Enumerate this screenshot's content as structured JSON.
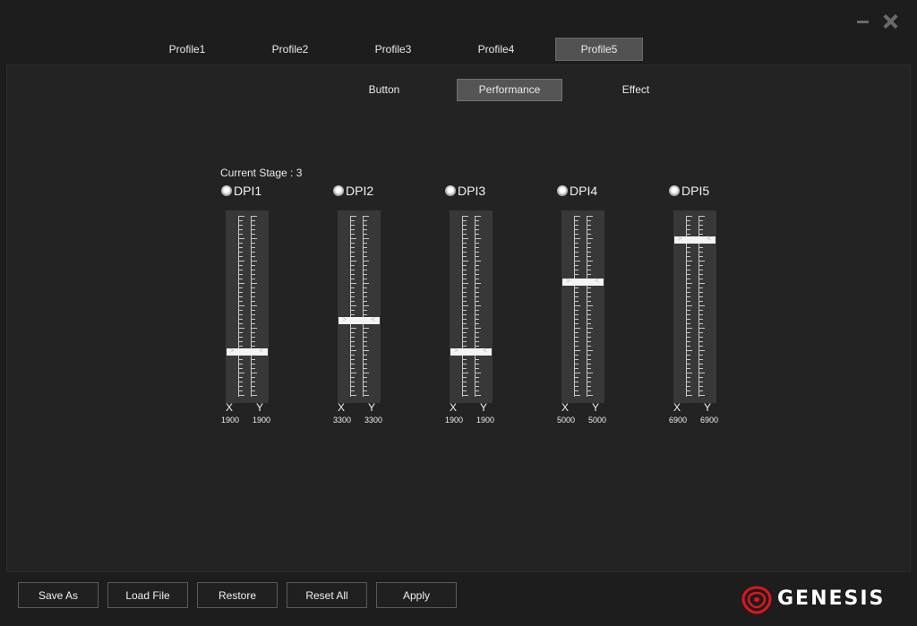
{
  "window": {
    "minimize_icon": "minimize-icon",
    "close_icon": "close-icon"
  },
  "profiles": {
    "tabs": [
      "Profile1",
      "Profile2",
      "Profile3",
      "Profile4",
      "Profile5"
    ],
    "active": "Profile5"
  },
  "subtabs": {
    "tabs": [
      "Button",
      "Performance",
      "Effect"
    ],
    "active": "Performance"
  },
  "performance": {
    "current_stage": "Current Stage : 3",
    "x_label": "X",
    "y_label": "Y",
    "dpi_stages": [
      {
        "label": "DPI1",
        "x": "1900",
        "y": "1900",
        "level": 0.245
      },
      {
        "label": "DPI2",
        "x": "3300",
        "y": "3300",
        "level": 0.425
      },
      {
        "label": "DPI3",
        "x": "1900",
        "y": "1900",
        "level": 0.245
      },
      {
        "label": "DPI4",
        "x": "5000",
        "y": "5000",
        "level": 0.645
      },
      {
        "label": "DPI5",
        "x": "6900",
        "y": "6900",
        "level": 0.885
      }
    ]
  },
  "footer": {
    "save_as": "Save As",
    "load_file": "Load File",
    "restore": "Restore",
    "reset_all": "Reset All",
    "apply": "Apply"
  },
  "brand": {
    "name": "GENESIS",
    "logo_icon": "genesis-logo-icon",
    "accent_color": "#e0141e"
  }
}
